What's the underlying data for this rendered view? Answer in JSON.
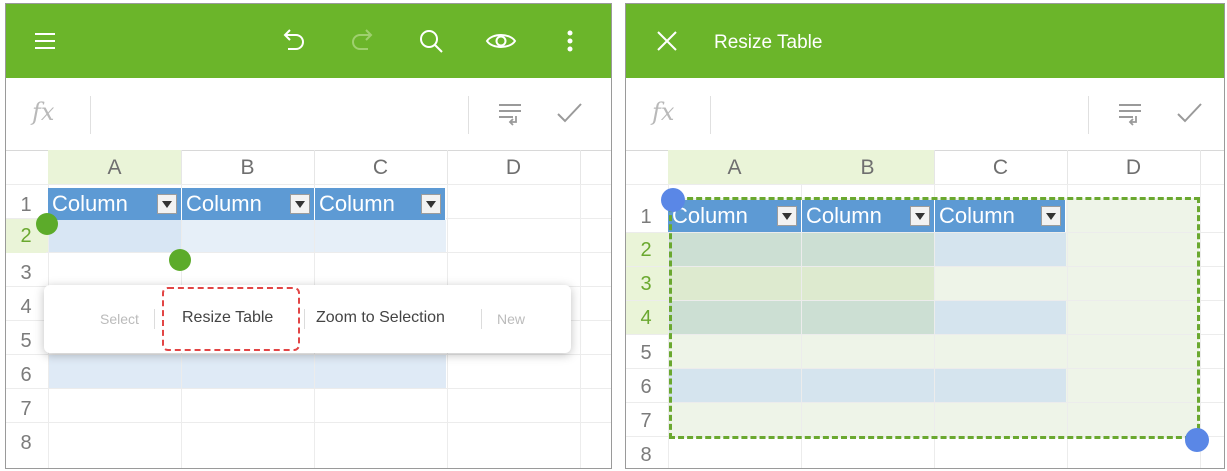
{
  "left": {
    "toolbar": {
      "menu_icon": "hamburger-menu-icon",
      "undo_icon": "undo-icon",
      "redo_icon": "redo-icon",
      "search_icon": "search-icon",
      "view_icon": "eye-icon",
      "more_icon": "more-vertical-icon"
    },
    "formula_bar": {
      "fx": "fx",
      "wrap_icon": "wrap-text-icon",
      "check_icon": "checkmark-icon"
    },
    "columns": [
      "A",
      "B",
      "C",
      "D"
    ],
    "rows": [
      "1",
      "2",
      "3",
      "4",
      "5",
      "6",
      "7",
      "8"
    ],
    "table_headers": [
      "Column",
      "Column",
      "Column"
    ],
    "context_menu": {
      "items": [
        "Select",
        "Resize Table",
        "Zoom to Selection",
        "New"
      ]
    }
  },
  "right": {
    "toolbar": {
      "close_icon": "close-icon",
      "title": "Resize Table"
    },
    "formula_bar": {
      "fx": "fx",
      "wrap_icon": "wrap-text-icon",
      "check_icon": "checkmark-icon"
    },
    "columns": [
      "A",
      "B",
      "C",
      "D"
    ],
    "rows": [
      "1",
      "2",
      "3",
      "4",
      "5",
      "6",
      "7",
      "8"
    ],
    "table_headers": [
      "Column",
      "Column",
      "Column"
    ]
  },
  "colors": {
    "toolbar": "#6bb52a",
    "table_header": "#5d9ad4",
    "band": "#dfeaf6",
    "selection_handle": "#5cab2a",
    "resize_handle": "#5a87e6",
    "highlight_border": "#e24545"
  }
}
